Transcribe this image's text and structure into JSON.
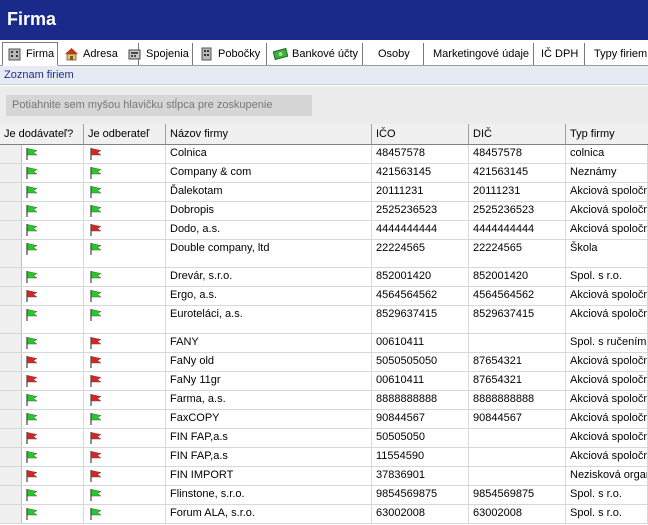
{
  "window": {
    "title": "Firma"
  },
  "tabs": [
    {
      "label": "Firma",
      "icon": "building-icon",
      "active": true
    },
    {
      "label": "Adresa",
      "icon": "house-icon"
    },
    {
      "label": "Spojenia",
      "icon": "phone-icon"
    },
    {
      "label": "Pobočky",
      "icon": "branch-building-icon"
    },
    {
      "label": "Bankové účty",
      "icon": "money-icon"
    },
    {
      "label": "Osoby"
    },
    {
      "label": "Marketingové údaje"
    },
    {
      "label": "IČ DPH"
    },
    {
      "label": "Typy firiem"
    }
  ],
  "section": {
    "title": "Zoznam firiem"
  },
  "grouping": {
    "hint": "Potiahnite sem myšou hlavičku stĺpca pre zoskupenie"
  },
  "colors": {
    "flag_green": "#22cc22",
    "flag_red": "#dd2222",
    "title_bg": "#1a2a8a"
  },
  "table": {
    "columns": [
      "Je dodávateľ?",
      "Je odberateľ",
      "Názov firmy",
      "IČO",
      "DIČ",
      "Typ firmy"
    ],
    "rows": [
      {
        "supplier": "green",
        "customer": "red",
        "name": "Colnica",
        "ico": "48457578",
        "dic": "48457578",
        "type": "colnica"
      },
      {
        "supplier": "green",
        "customer": "green",
        "name": "Company & com",
        "ico": "421563145",
        "dic": "421563145",
        "type": "Neznámy"
      },
      {
        "supplier": "green",
        "customer": "green",
        "name": "Ďalekotam",
        "ico": "20111231",
        "dic": "20111231",
        "type": "Akciová spoločnosť"
      },
      {
        "supplier": "green",
        "customer": "green",
        "name": "Dobropis",
        "ico": "2525236523",
        "dic": "2525236523",
        "type": "Akciová spoločnosť"
      },
      {
        "supplier": "green",
        "customer": "red",
        "name": "Dodo, a.s.",
        "ico": "4444444444",
        "dic": "4444444444",
        "type": "Akciová spoločnosť"
      },
      {
        "supplier": "green",
        "customer": "green",
        "name": "Double company, ltd",
        "ico": "22224565",
        "dic": "22224565",
        "type": "Škola",
        "tall": true
      },
      {
        "supplier": "green",
        "customer": "green",
        "name": "Drevár, s.r.o.",
        "ico": "852001420",
        "dic": "852001420",
        "type": "Spol. s r.o."
      },
      {
        "supplier": "red",
        "customer": "green",
        "name": "Ergo, a.s.",
        "ico": "4564564562",
        "dic": "4564564562",
        "type": "Akciová spoločnosť"
      },
      {
        "supplier": "green",
        "customer": "green",
        "name": "Euroteláci, a.s.",
        "ico": "8529637415",
        "dic": "8529637415",
        "type": "Akciová spoločnosť",
        "tall": true
      },
      {
        "supplier": "green",
        "customer": "red",
        "name": "FANY",
        "ico": "00610411",
        "dic": "",
        "type": "Spol. s ručením obmedzeným"
      },
      {
        "supplier": "red",
        "customer": "red",
        "name": "FaNy old",
        "ico": "5050505050",
        "dic": "87654321",
        "type": "Akciová spoločnosť"
      },
      {
        "supplier": "red",
        "customer": "red",
        "name": "FaNy 11gr",
        "ico": "00610411",
        "dic": "87654321",
        "type": "Akciová spoločnosť"
      },
      {
        "supplier": "green",
        "customer": "red",
        "name": "Farma, a.s.",
        "ico": "8888888888",
        "dic": "8888888888",
        "type": "Akciová spoločnosť"
      },
      {
        "supplier": "green",
        "customer": "green",
        "name": "FaxCOPY",
        "ico": "90844567",
        "dic": "90844567",
        "type": "Akciová spoločnosť"
      },
      {
        "supplier": "red",
        "customer": "red",
        "name": "FIN FAP,a.s",
        "ico": "50505050",
        "dic": "",
        "type": "Akciová spoločnosť"
      },
      {
        "supplier": "green",
        "customer": "red",
        "name": "FIN FAP,a.s",
        "ico": "11554590",
        "dic": "",
        "type": "Akciová spoločnosť"
      },
      {
        "supplier": "red",
        "customer": "red",
        "name": "FIN IMPORT",
        "ico": "37836901",
        "dic": "",
        "type": "Nezisková organizácia"
      },
      {
        "supplier": "green",
        "customer": "green",
        "name": "Flinstone, s.r.o.",
        "ico": "9854569875",
        "dic": "9854569875",
        "type": "Spol. s r.o."
      },
      {
        "supplier": "green",
        "customer": "green",
        "name": "Forum ALA, s.r.o.",
        "ico": "63002008",
        "dic": "63002008",
        "type": "Spol. s r.o."
      }
    ]
  }
}
